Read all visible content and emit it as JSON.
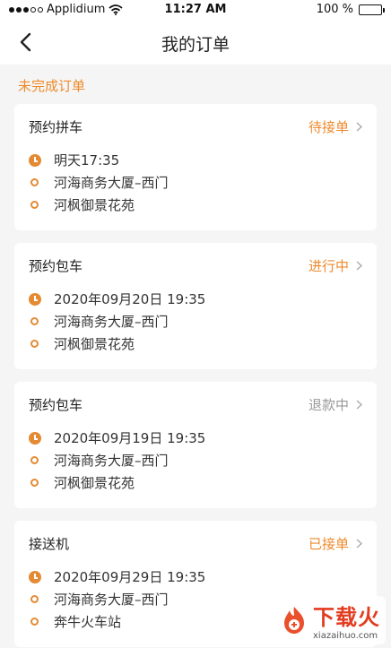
{
  "status_bar": {
    "carrier": "Applidium",
    "time": "11:27 AM",
    "battery": "100 %",
    "battery_level": 1.0
  },
  "nav": {
    "title": "我的订单",
    "back_icon": "chevron-left-icon"
  },
  "section_title": "未完成订单",
  "colors": {
    "accent": "#ee8a2c",
    "muted": "#999999"
  },
  "orders": [
    {
      "type": "预约拼车",
      "status": "待接单",
      "status_color": "#ee8a2c",
      "time": "明天17:35",
      "from": "河海商务大厦–西门",
      "to": "河枫御景花苑"
    },
    {
      "type": "预约包车",
      "status": "进行中",
      "status_color": "#ee8a2c",
      "time": "2020年09月20日 19:35",
      "from": "河海商务大厦–西门",
      "to": "河枫御景花苑"
    },
    {
      "type": "预约包车",
      "status": "退款中",
      "status_color": "#999999",
      "time": "2020年09月19日 19:35",
      "from": "河海商务大厦–西门",
      "to": "河枫御景花苑"
    },
    {
      "type": "接送机",
      "status": "已接单",
      "status_color": "#ee8a2c",
      "time": "2020年09月29日 19:35",
      "from": "河海商务大厦–西门",
      "to": "奔牛火车站"
    }
  ],
  "watermark": {
    "brand": "下载火",
    "url": "xiazaihuo.com"
  }
}
